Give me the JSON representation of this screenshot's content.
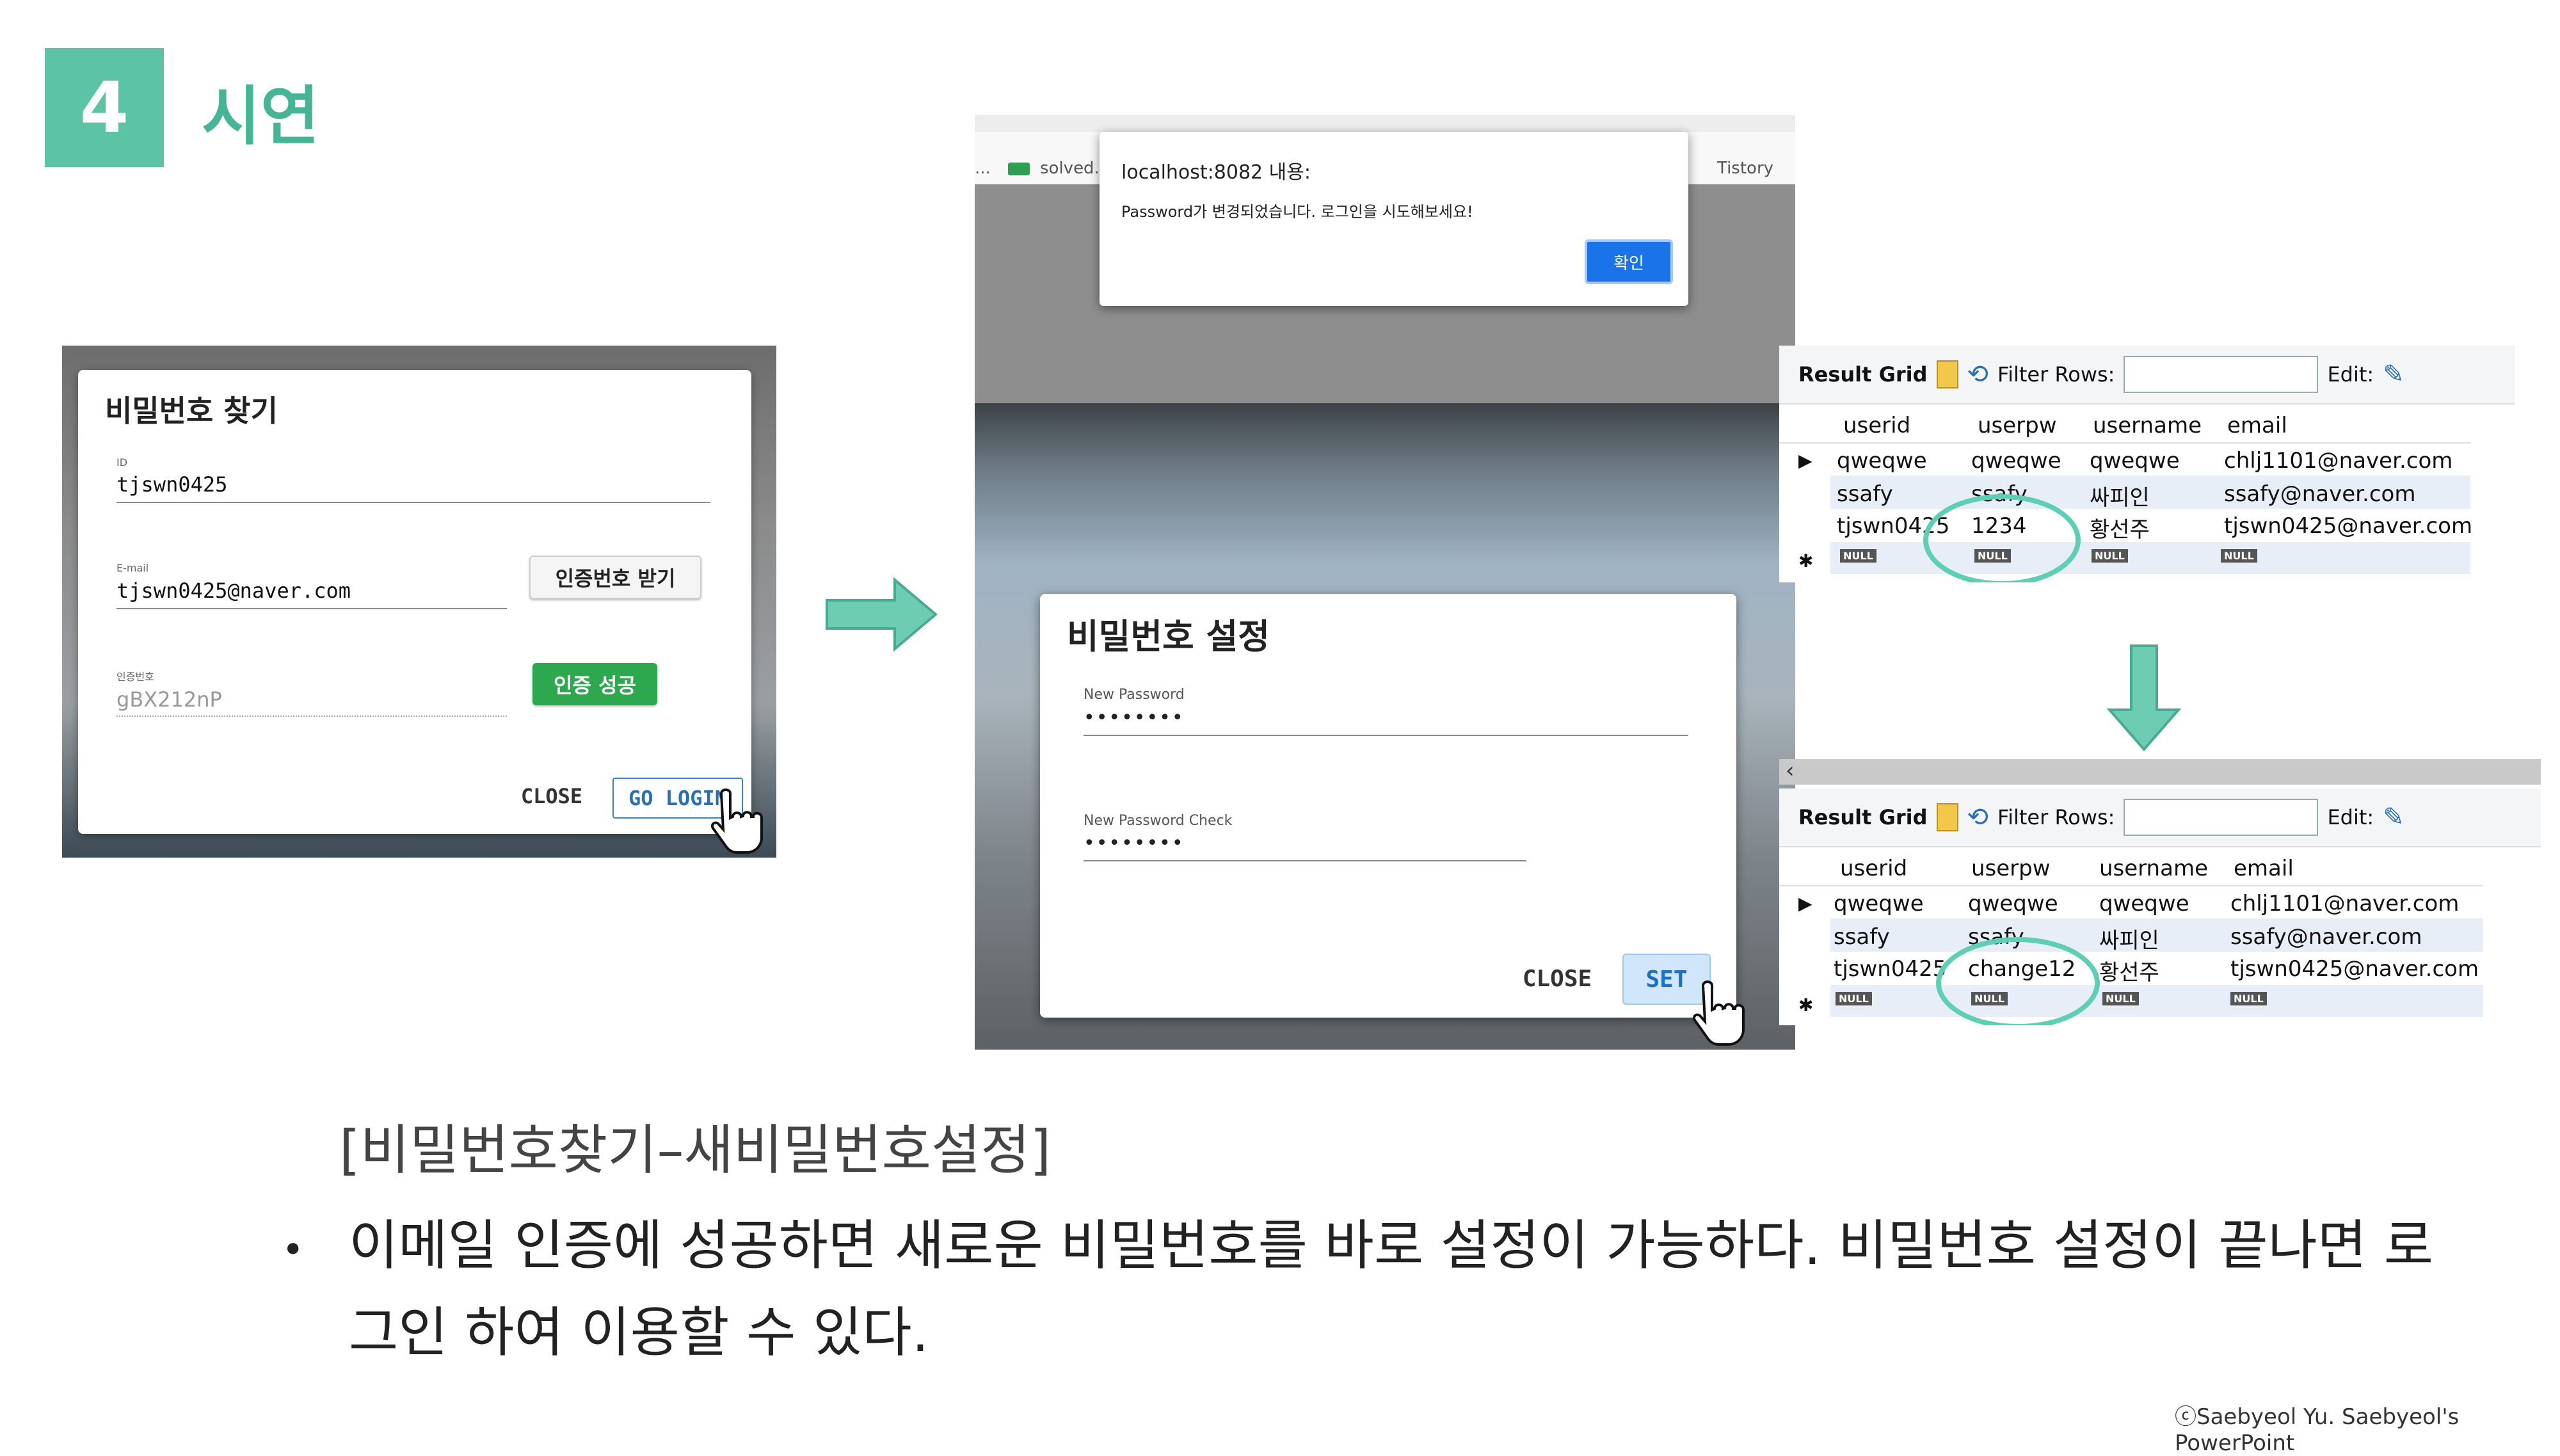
{
  "slide": {
    "number": "4",
    "title": "시연",
    "caption": "[비밀번호찾기–새비밀번호설정]",
    "bullet": "•",
    "body": "이메일 인증에 성공하면 새로운 비밀번호를 바로 설정이 가능하다. 비밀번호 설정이 끝나면 로그인 하여 이용할 수 있다.",
    "copyright": "ⓒSaebyeol Yu. Saebyeol's PowerPoint"
  },
  "find_password": {
    "title": "비밀번호 찾기",
    "id_label": "ID",
    "id_value": "tjswn0425",
    "email_label": "E-mail",
    "email_value": "tjswn0425@naver.com",
    "get_code_button": "인증번호 받기",
    "code_label": "인증번호",
    "code_value": "gBX212nP",
    "verify_button": "인증 성공",
    "close_button": "CLOSE",
    "go_login_button": "GO LOGIN"
  },
  "browser": {
    "bookmark_left": "...",
    "bookmark_1": "solved.a",
    "bookmark_2": "Tistory"
  },
  "alert": {
    "title": "localhost:8082 내용:",
    "message": "Password가 변경되었습니다. 로그인을 시도해보세요!",
    "ok_button": "확인"
  },
  "set_password": {
    "title": "비밀번호 설정",
    "new_label": "New Password",
    "new_value": "••••••••",
    "check_label": "New Password Check",
    "check_value": "••••••••",
    "close_button": "CLOSE",
    "set_button": "SET"
  },
  "grid_toolbar": {
    "result_grid": "Result Grid",
    "filter_rows": "Filter Rows:",
    "edit": "Edit:"
  },
  "grid_columns": [
    "userid",
    "userpw",
    "username",
    "email"
  ],
  "grid_before": {
    "rows": [
      [
        "qweqwe",
        "qweqwe",
        "qweqwe",
        "chlj1101@naver.com"
      ],
      [
        "ssafy",
        "ssafy",
        "싸피인",
        "ssafy@naver.com"
      ],
      [
        "tjswn0425",
        "1234",
        "황선주",
        "tjswn0425@naver.com"
      ]
    ]
  },
  "grid_after": {
    "rows": [
      [
        "qweqwe",
        "qweqwe",
        "qweqwe",
        "chlj1101@naver.com"
      ],
      [
        "ssafy",
        "ssafy",
        "싸피인",
        "ssafy@naver.com"
      ],
      [
        "tjswn0425",
        "change12",
        "황선주",
        "tjswn0425@naver.com"
      ]
    ]
  },
  "null_label": "NULL",
  "colors": {
    "accent": "#5cc4a4",
    "title": "#45b596",
    "ring": "#5ecfb4"
  }
}
